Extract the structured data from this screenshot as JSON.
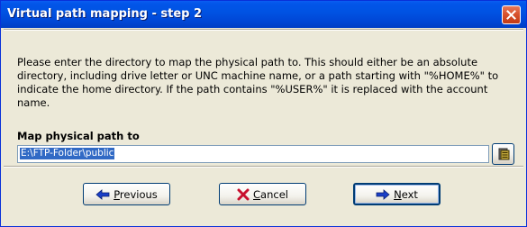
{
  "window": {
    "title": "Virtual path mapping - step 2"
  },
  "description": "Please enter the directory to map the physical path to. This should either be an absolute directory, including drive letter or UNC machine name, or a path starting with \"%HOME%\" to indicate the home directory. If the path contains \"%USER%\" it is replaced with the account name.",
  "field": {
    "label": "Map physical path to",
    "value": "E:\\FTP-Folder\\public",
    "browse_icon": "folder-browse-icon"
  },
  "buttons": {
    "previous": {
      "mnemonic": "P",
      "rest": "revious",
      "icon": "arrow-left-icon"
    },
    "cancel": {
      "mnemonic": "C",
      "rest": "ancel",
      "icon": "x-icon"
    },
    "next": {
      "mnemonic": "N",
      "rest": "ext",
      "icon": "arrow-right-icon"
    }
  },
  "colors": {
    "titlebar": "#0053E3",
    "close": "#D8532E",
    "selection": "#316AC5",
    "arrow": "#1A3FC8",
    "cancel_x": "#C8102E"
  }
}
